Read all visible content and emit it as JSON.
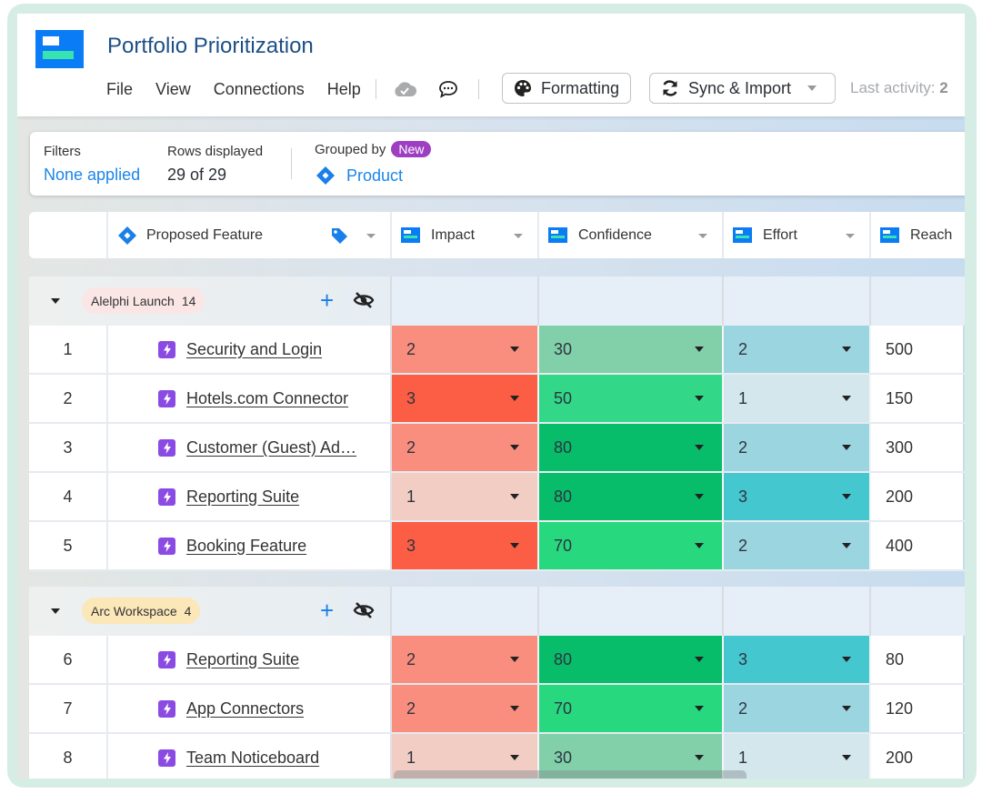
{
  "app": {
    "title": "Portfolio Prioritization",
    "menu": [
      "File",
      "View",
      "Connections",
      "Help"
    ],
    "icons": {
      "sync_status": "cloud-check-icon",
      "comments": "chat-bubble-icon"
    },
    "formatting_label": "Formatting",
    "sync_label": "Sync & Import",
    "last_activity_label": "Last activity:",
    "last_activity_value": "2"
  },
  "filterbar": {
    "filters_label": "Filters",
    "filters_value": "None applied",
    "rows_label": "Rows displayed",
    "rows_value": "29 of 29",
    "grouped_label": "Grouped by",
    "new_badge": "New",
    "grouped_value": "Product"
  },
  "columns": {
    "feature": "Proposed Feature",
    "impact": "Impact",
    "confidence": "Confidence",
    "effort": "Effort",
    "reach": "Reach"
  },
  "colors": {
    "impact": {
      "1": "#f2cdc4",
      "2": "#f98e7e",
      "3": "#fb5e45"
    },
    "confidence": {
      "30": "#81d0aa",
      "50": "#32d888",
      "70": "#27d87e",
      "80": "#07bd6a"
    },
    "effort": {
      "1": "#d3e7ec",
      "2": "#9bd5e0",
      "3": "#45c7d0"
    },
    "group_pills": {
      "alelphi": "#fbe6e6",
      "arc": "#fbe7b8"
    }
  },
  "groups": [
    {
      "name": "Alelphi Launch",
      "count": "14",
      "rows": [
        {
          "num": "1",
          "feature": "Security and Login",
          "impact": "2",
          "confidence": "30",
          "effort": "2",
          "reach": "500"
        },
        {
          "num": "2",
          "feature": "Hotels.com Connector",
          "impact": "3",
          "confidence": "50",
          "effort": "1",
          "reach": "150"
        },
        {
          "num": "3",
          "feature": "Customer (Guest) Ad…",
          "impact": "2",
          "confidence": "80",
          "effort": "2",
          "reach": "300"
        },
        {
          "num": "4",
          "feature": "Reporting Suite",
          "impact": "1",
          "confidence": "80",
          "effort": "3",
          "reach": "200"
        },
        {
          "num": "5",
          "feature": "Booking Feature",
          "impact": "3",
          "confidence": "70",
          "effort": "2",
          "reach": "400"
        }
      ]
    },
    {
      "name": "Arc Workspace",
      "count": "4",
      "rows": [
        {
          "num": "6",
          "feature": "Reporting Suite",
          "impact": "2",
          "confidence": "80",
          "effort": "3",
          "reach": "80"
        },
        {
          "num": "7",
          "feature": "App Connectors",
          "impact": "2",
          "confidence": "70",
          "effort": "2",
          "reach": "120"
        },
        {
          "num": "8",
          "feature": "Team Noticeboard",
          "impact": "1",
          "confidence": "30",
          "effort": "1",
          "reach": "200"
        }
      ]
    }
  ]
}
